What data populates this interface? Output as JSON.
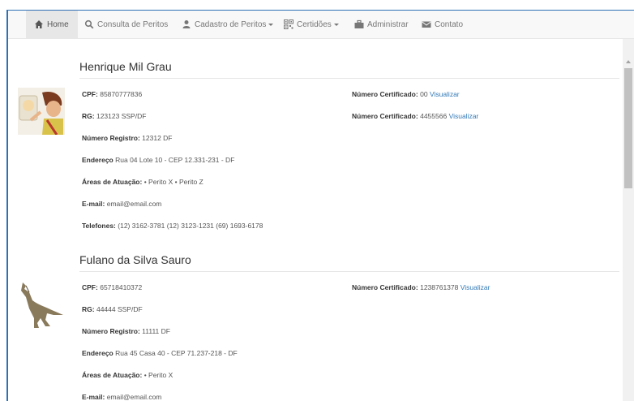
{
  "nav": {
    "home": "Home",
    "consulta": "Consulta de Peritos",
    "cadastro": "Cadastro de Peritos",
    "certidoes": "Certidões",
    "administrar": "Administrar",
    "contato": "Contato"
  },
  "labels": {
    "cpf": "CPF:",
    "rg": "RG:",
    "registro": "Número Registro:",
    "endereco": "Endereço",
    "areas": "Áreas de Atuação:",
    "email": "E-mail:",
    "telefones": "Telefones:",
    "certificado": "Número Certificado:",
    "visualizar": "Visualizar"
  },
  "peritos": [
    {
      "name": "Henrique Mil Grau",
      "cpf": "85870777836",
      "rg": "123123 SSP/DF",
      "registro": "12312 DF",
      "endereco": "Rua 04 Lote 10 - CEP 12.331-231 - DF",
      "areas": "• Perito X • Perito Z",
      "email": "email@email.com",
      "telefones": "(12) 3162-3781 (12) 3123-1231 (69) 1693-6178",
      "certificados": [
        "00",
        "4455566"
      ]
    },
    {
      "name": "Fulano da Silva Sauro",
      "cpf": "65718410372",
      "rg": "44444 SSP/DF",
      "registro": "11111 DF",
      "endereco": "Rua 45 Casa 40 - CEP 71.237-218 - DF",
      "areas": "• Perito X",
      "email": "email@email.com",
      "certificados": [
        "1238761378"
      ]
    }
  ]
}
